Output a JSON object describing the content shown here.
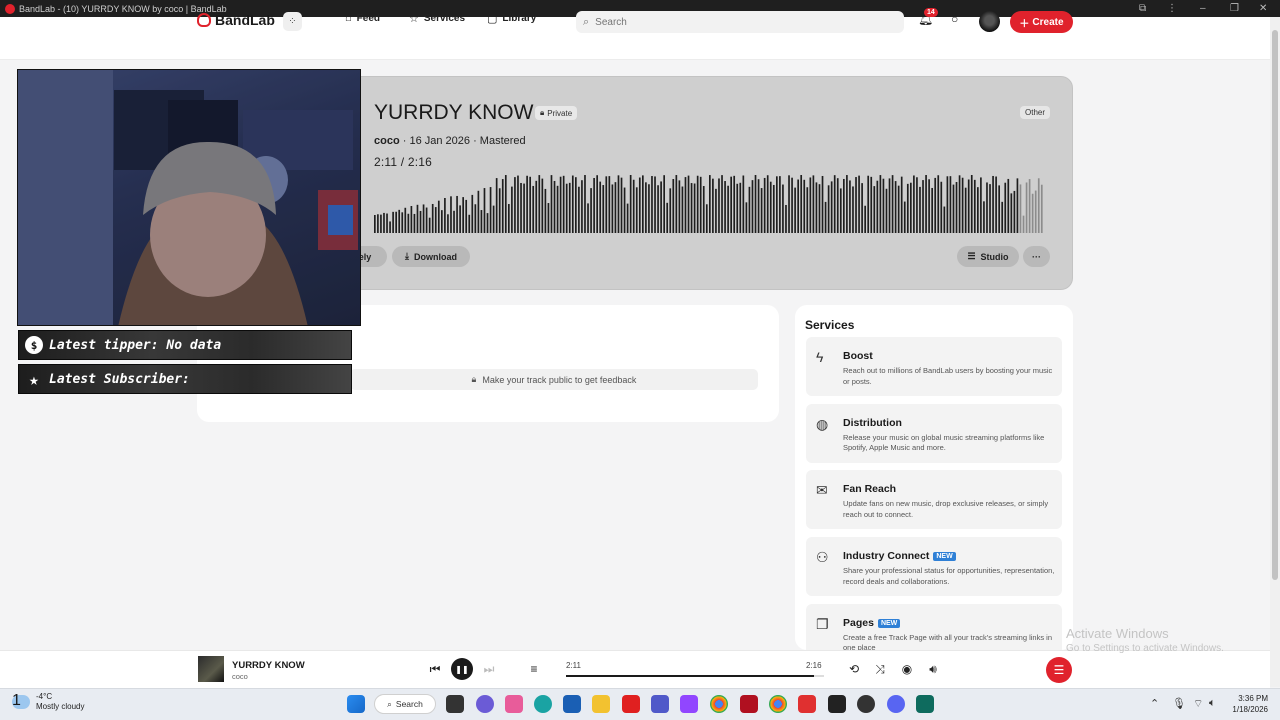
{
  "window": {
    "title": "BandLab - (10) YURRDY KNOW by coco | BandLab"
  },
  "nav": {
    "brand": "BandLab",
    "feed": "Feed",
    "services": "Services",
    "library": "Library",
    "search_placeholder": "Search",
    "notifications_count": "14",
    "create": "Create"
  },
  "track": {
    "title": "YURRDY KNOW",
    "visibility": "Private",
    "genre": "Other",
    "artist": "coco",
    "meta": " · 16 Jan 2026 · Mastered",
    "time": "2:11 /  2:16",
    "btn_left_partial": "tely",
    "download": "Download",
    "studio": "Studio",
    "more": "···",
    "progress_fraction": 0.963
  },
  "feedback": {
    "text": "Make your track public to get feedback"
  },
  "services": {
    "heading": "Services",
    "items": [
      {
        "title": "Boost",
        "desc": "Reach out to millions of BandLab users by boosting your music or posts.",
        "icon": "bolt-icon",
        "new": ""
      },
      {
        "title": "Distribution",
        "desc": "Release your music on global music streaming platforms like Spotify, Apple Music and more.",
        "icon": "globe-note-icon",
        "new": ""
      },
      {
        "title": "Fan Reach",
        "desc": "Update fans on new music, drop exclusive releases, or simply reach out to connect.",
        "icon": "mail-icon",
        "new": ""
      },
      {
        "title": "Industry Connect",
        "desc": "Share your professional status for opportunities, representation, record deals and collaborations.",
        "icon": "people-icon",
        "new": "NEW"
      },
      {
        "title": "Pages",
        "desc": "Create a free Track Page with all your track's streaming links in one place",
        "icon": "pages-icon",
        "new": "NEW"
      }
    ]
  },
  "stream_overlay": {
    "tipper": "Latest tipper: No data",
    "subscriber": "Latest Subscriber:"
  },
  "player": {
    "title": "YURRDY KNOW",
    "artist": "coco",
    "current": "2:11",
    "total": "2:16"
  },
  "watermark": {
    "line1": "Activate Windows",
    "line2": "Go to Settings to activate Windows."
  },
  "taskbar": {
    "temp": "-4°C",
    "weather": "Mostly cloudy",
    "weather_badge": "1",
    "search": "Search",
    "time": "3:36 PM",
    "date": "1/18/2026"
  },
  "colors": {
    "accent": "#e0222c",
    "new_tag": "#2f80d6"
  }
}
